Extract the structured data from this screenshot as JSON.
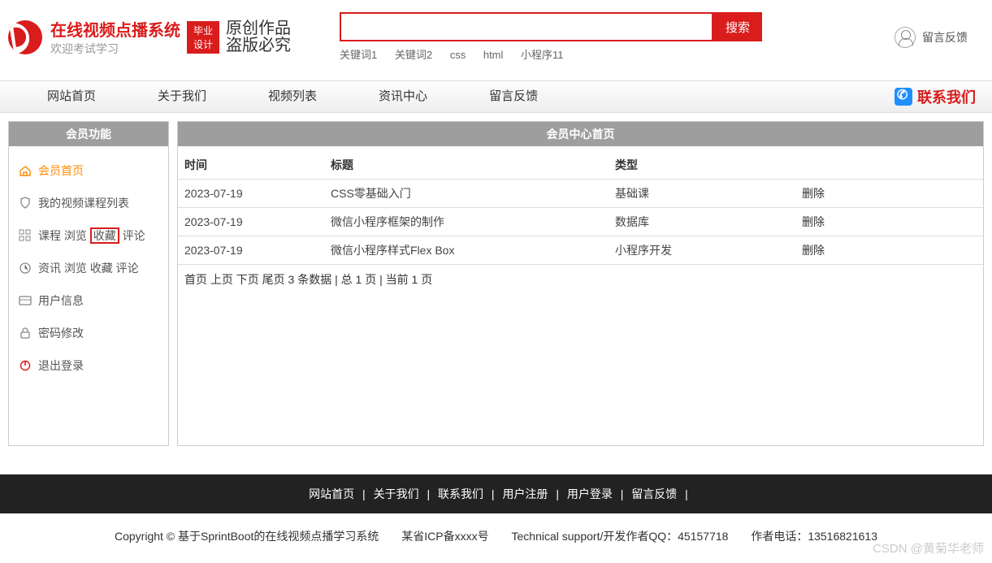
{
  "header": {
    "title": "在线视频点播系统",
    "subtitle": "欢迎考试学习",
    "badge_line1": "毕业",
    "badge_line2": "设计",
    "slogan_line1": "原创作品",
    "slogan_line2": "盗版必究",
    "search_btn": "搜索",
    "keywords": [
      "关键词1",
      "关键词2",
      "css",
      "html",
      "小程序11"
    ],
    "feedback": "留言反馈"
  },
  "nav": {
    "items": [
      "网站首页",
      "关于我们",
      "视频列表",
      "资讯中心",
      "留言反馈"
    ],
    "contact": "联系我们"
  },
  "sidebar": {
    "title": "会员功能",
    "items": [
      {
        "label": "会员首页"
      },
      {
        "label": "我的视频课程列表"
      },
      {
        "prefix": "课程 浏览 ",
        "highlight": "收藏",
        "suffix": " 评论"
      },
      {
        "label": "资讯 浏览 收藏 评论"
      },
      {
        "label": "用户信息"
      },
      {
        "label": "密码修改"
      },
      {
        "label": "退出登录"
      }
    ]
  },
  "content": {
    "title": "会员中心首页",
    "headers": [
      "时间",
      "标题",
      "类型",
      ""
    ],
    "rows": [
      {
        "time": "2023-07-19",
        "title": "CSS零基础入门",
        "type": "基础课",
        "action": "删除"
      },
      {
        "time": "2023-07-19",
        "title": "微信小程序框架的制作",
        "type": "数据库",
        "action": "删除"
      },
      {
        "time": "2023-07-19",
        "title": "微信小程序样式Flex Box",
        "type": "小程序开发",
        "action": "删除"
      }
    ],
    "pager": "首页 上页 下页 尾页 3 条数据 | 总 1 页 | 当前 1 页"
  },
  "footer": {
    "nav": [
      "网站首页",
      "关于我们",
      "联系我们",
      "用户注册",
      "用户登录",
      "留言反馈"
    ],
    "copyright": "Copyright © 基于SprintBoot的在线视频点播学习系统",
    "icp": "某省ICP备xxxx号",
    "support": "Technical support/开发作者QQ：45157718",
    "phone": "作者电话：13516821613"
  },
  "watermark": "CSDN @黄菊华老师"
}
